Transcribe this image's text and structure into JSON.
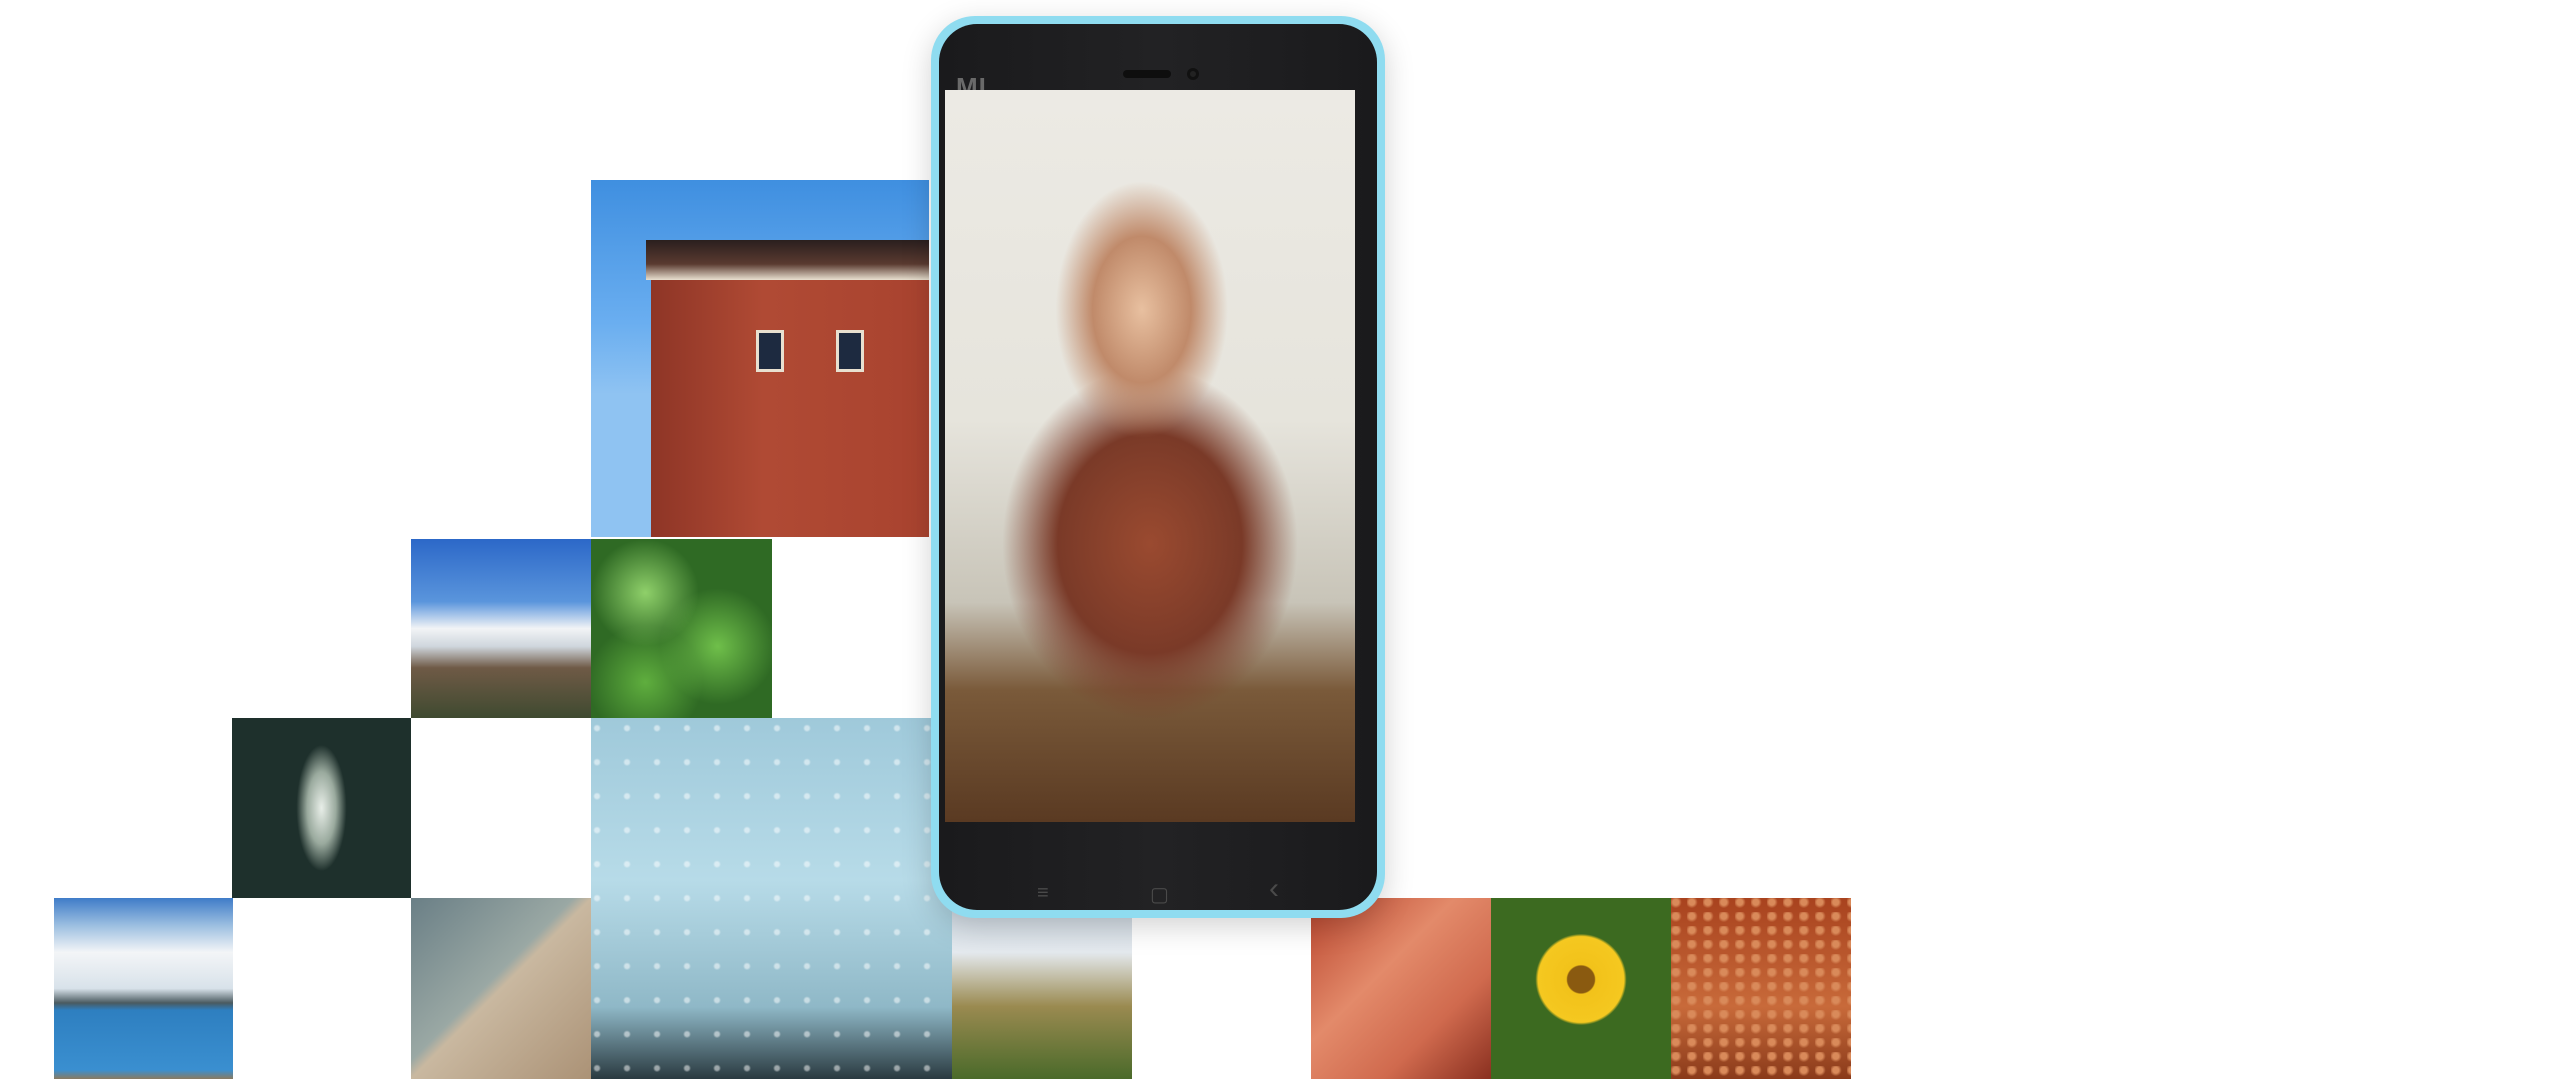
{
  "phone": {
    "brand_logo": "MI",
    "frame_color": "#8fdcf0",
    "body_color": "#1d1d1f",
    "nav_keys": [
      {
        "icon": "menu-icon",
        "glyph": "≡"
      },
      {
        "icon": "home-icon",
        "glyph": "▢"
      },
      {
        "icon": "back-icon",
        "glyph": "‹"
      }
    ]
  },
  "gallery": {
    "photos": [
      "red-tibetan-building",
      "mountains-clouds",
      "green-leaves",
      "sparkling-water",
      "raindrops-on-glass",
      "blue-lake",
      "palm-shadow",
      "grass-and-house",
      "red-wall",
      "yellow-flower",
      "red-gravel"
    ]
  }
}
